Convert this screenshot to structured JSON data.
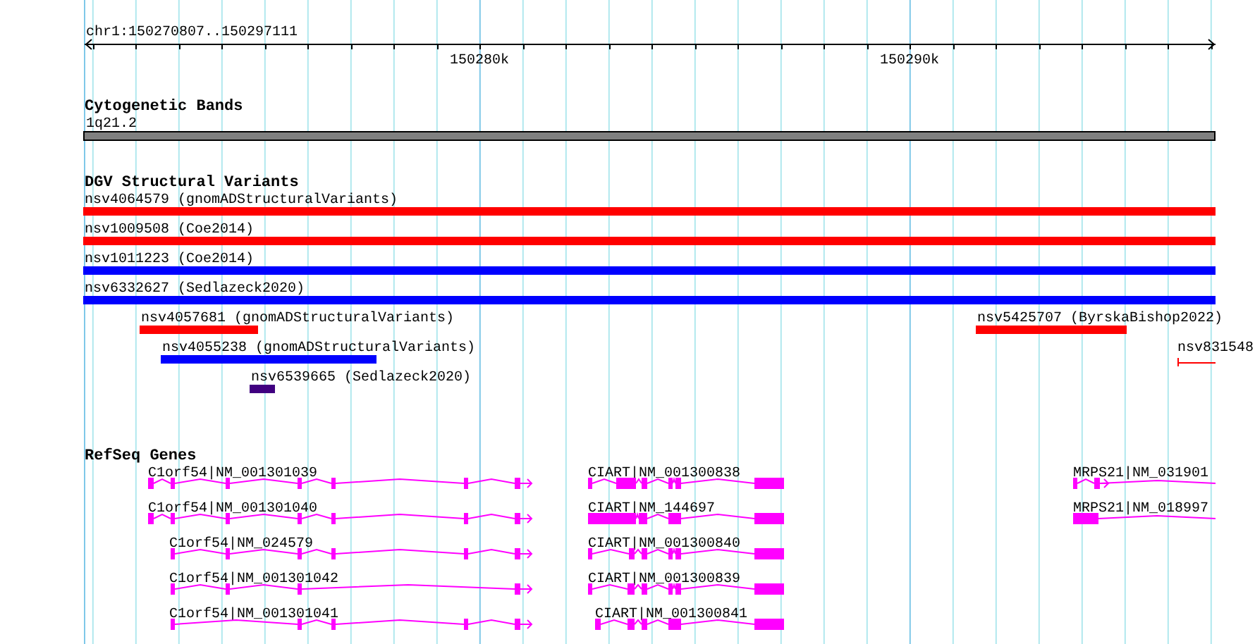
{
  "ruler": {
    "region": "chr1:150270807..150297111",
    "ticks": [
      "150280k",
      "150290k"
    ]
  },
  "cytogenetic_bands": {
    "title": "Cytogenetic Bands",
    "bands": [
      {
        "label": "1q21.2"
      }
    ]
  },
  "dgv_structural_variants": {
    "title": "DGV Structural Variants",
    "variants": [
      {
        "label": "nsv4064579 (gnomADStructuralVariants)",
        "color": "#ff0000"
      },
      {
        "label": "nsv1009508 (Coe2014)",
        "color": "#ff0000"
      },
      {
        "label": "nsv1011223 (Coe2014)",
        "color": "#0000ff"
      },
      {
        "label": "nsv6332627 (Sedlazeck2020)",
        "color": "#0000ff"
      },
      {
        "label": "nsv4057681 (gnomADStructuralVariants)",
        "color": "#ff0000"
      },
      {
        "label": "nsv5425707 (ByrskaBishop2022)",
        "color": "#ff0000"
      },
      {
        "label": "nsv4055238 (gnomADStructuralVariants)",
        "color": "#0000ff"
      },
      {
        "label": "nsv831548",
        "color": "#ff0000"
      },
      {
        "label": "nsv6539665 (Sedlazeck2020)",
        "color": "#400080"
      }
    ]
  },
  "refseq_genes": {
    "title": "RefSeq Genes",
    "genes": [
      {
        "label": "C1orf54|NM_001301039"
      },
      {
        "label": "CIART|NM_001300838"
      },
      {
        "label": "MRPS21|NM_031901"
      },
      {
        "label": "C1orf54|NM_001301040"
      },
      {
        "label": "CIART|NM_144697"
      },
      {
        "label": "MRPS21|NM_018997"
      },
      {
        "label": "C1orf54|NM_024579"
      },
      {
        "label": "CIART|NM_001300840"
      },
      {
        "label": "C1orf54|NM_001301042"
      },
      {
        "label": "CIART|NM_001300839"
      },
      {
        "label": "C1orf54|NM_001301041"
      },
      {
        "label": "CIART|NM_001300841"
      }
    ]
  }
}
